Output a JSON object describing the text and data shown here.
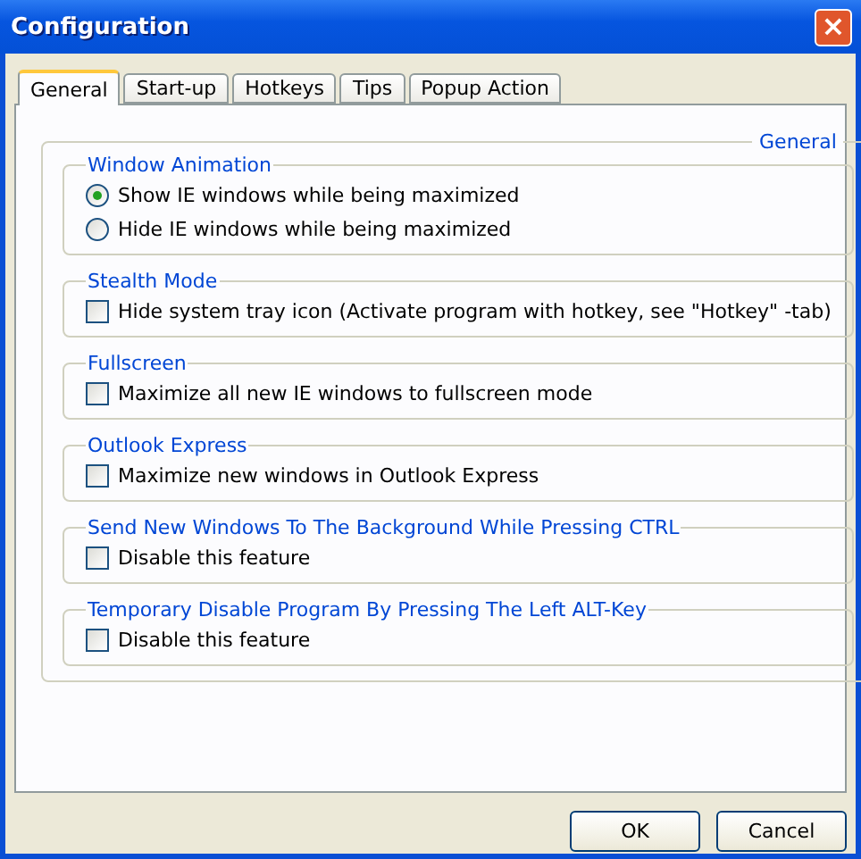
{
  "window": {
    "title": "Configuration",
    "close": "×"
  },
  "tabs": [
    {
      "label": "General",
      "selected": true
    },
    {
      "label": "Start-up",
      "selected": false
    },
    {
      "label": "Hotkeys",
      "selected": false
    },
    {
      "label": "Tips",
      "selected": false
    },
    {
      "label": "Popup Action",
      "selected": false
    }
  ],
  "panel": {
    "title": "General",
    "groups": [
      {
        "title": "Window Animation",
        "items": [
          {
            "kind": "radio",
            "label": "Show IE windows while being maximized",
            "selected": true
          },
          {
            "kind": "radio",
            "label": "Hide IE windows while being maximized",
            "selected": false
          }
        ]
      },
      {
        "title": "Stealth Mode",
        "items": [
          {
            "kind": "checkbox",
            "label": "Hide system tray icon (Activate program with hotkey, see \"Hotkey\" -tab)",
            "checked": false
          }
        ]
      },
      {
        "title": "Fullscreen",
        "items": [
          {
            "kind": "checkbox",
            "label": "Maximize all new IE windows to fullscreen mode",
            "checked": false
          }
        ]
      },
      {
        "title": "Outlook Express",
        "items": [
          {
            "kind": "checkbox",
            "label": "Maximize new windows in Outlook Express",
            "checked": false
          }
        ]
      },
      {
        "title": "Send New Windows To The Background While Pressing CTRL",
        "items": [
          {
            "kind": "checkbox",
            "label": "Disable this feature",
            "checked": false
          }
        ]
      },
      {
        "title": "Temporary Disable Program By Pressing The Left ALT-Key",
        "items": [
          {
            "kind": "checkbox",
            "label": "Disable this feature",
            "checked": false
          }
        ]
      }
    ]
  },
  "buttons": [
    "OK",
    "Cancel"
  ]
}
